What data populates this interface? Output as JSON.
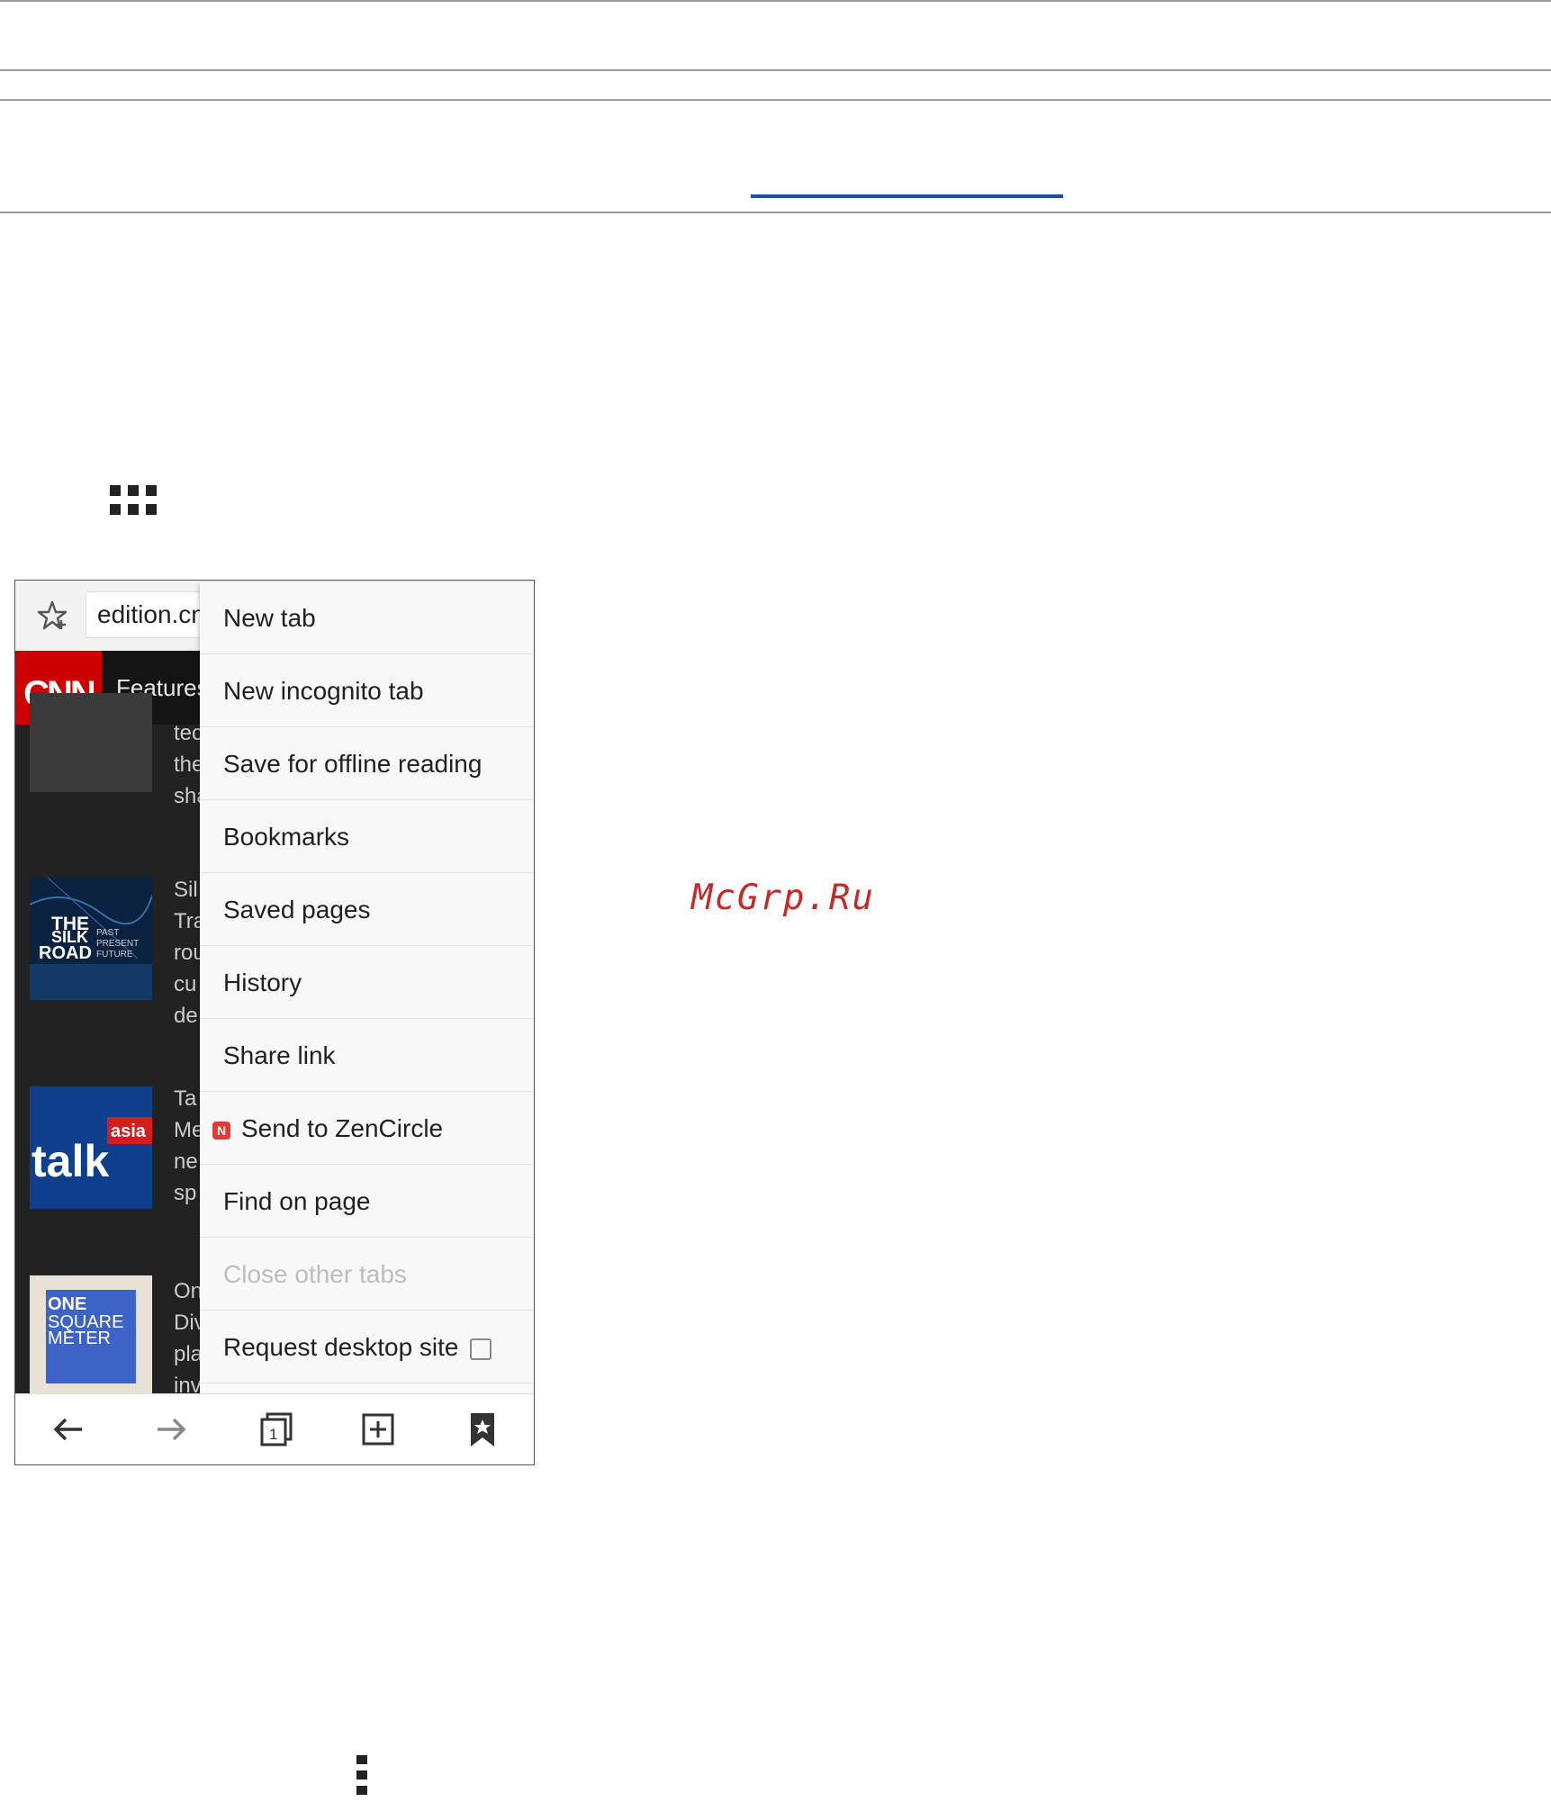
{
  "page": {
    "watermark": "McGrp.Ru"
  },
  "browser": {
    "url": "edition.cnn.com",
    "site_logo": "CNN",
    "section_label": "Features",
    "feed": [
      {
        "thumb": "dark",
        "lines": [
          "tec",
          "the",
          "sha"
        ]
      },
      {
        "thumb": "The Silk Road",
        "lines": [
          "Sil",
          "Tra",
          "rou",
          "cu",
          "de"
        ]
      },
      {
        "thumb": "talk asia",
        "lines": [
          "Ta",
          "Me",
          "ne",
          "sp"
        ]
      },
      {
        "thumb": "One Square Meter",
        "lines": [
          "On",
          "Div",
          "pla",
          "inv"
        ]
      }
    ],
    "menu": {
      "items": [
        {
          "label": "New tab",
          "enabled": true
        },
        {
          "label": "New incognito tab",
          "enabled": true
        },
        {
          "label": "Save for offline reading",
          "enabled": true
        },
        {
          "label": "Bookmarks",
          "enabled": true
        },
        {
          "label": "Saved pages",
          "enabled": true
        },
        {
          "label": "History",
          "enabled": true
        },
        {
          "label": "Share link",
          "enabled": true
        },
        {
          "label": "Send to ZenCircle",
          "enabled": true,
          "icon": "zencircle-icon",
          "icon_text": "N"
        },
        {
          "label": "Find on page",
          "enabled": true
        },
        {
          "label": "Close other tabs",
          "enabled": false
        },
        {
          "label": "Request desktop site",
          "enabled": true,
          "checkbox": false
        }
      ]
    },
    "bottom_nav": [
      "back-icon",
      "forward-icon",
      "tabs-icon",
      "new-tab-icon",
      "bookmark-icon"
    ],
    "tabs_count": "1"
  },
  "thumb_text": {
    "silk": [
      "THE",
      "SILK",
      "ROAD",
      "PAST",
      "PRESENT",
      "FUTURE"
    ],
    "talk": [
      "talk",
      "asia"
    ],
    "one": [
      "ONE",
      "SQUARE",
      "METER"
    ]
  },
  "colors": {
    "accent_tab": "#1d4fa3",
    "cnn_red": "#cc0000",
    "watermark": "#c72828"
  }
}
